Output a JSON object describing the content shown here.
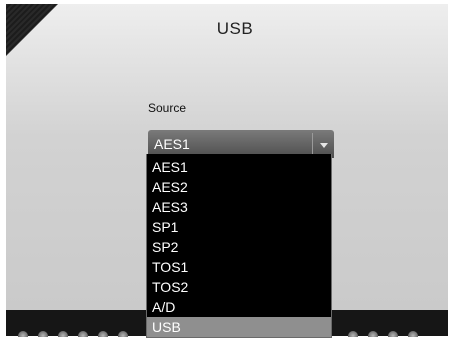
{
  "window": {
    "title": "USB"
  },
  "source": {
    "label": "Source",
    "selected_value": "AES1",
    "options": [
      "AES1",
      "AES2",
      "AES3",
      "SP1",
      "SP2",
      "TOS1",
      "TOS2",
      "A/D",
      "USB"
    ],
    "highlighted_option": "USB"
  },
  "colors": {
    "panel_background": "#d2d2d2",
    "dropdown_background": "#000000",
    "highlight": "#8f8f8f",
    "select_background": "#5a5a5a"
  },
  "icons": {
    "dropdown_arrow": "chevron-down-icon",
    "indicator": "led-indicator-icon"
  }
}
